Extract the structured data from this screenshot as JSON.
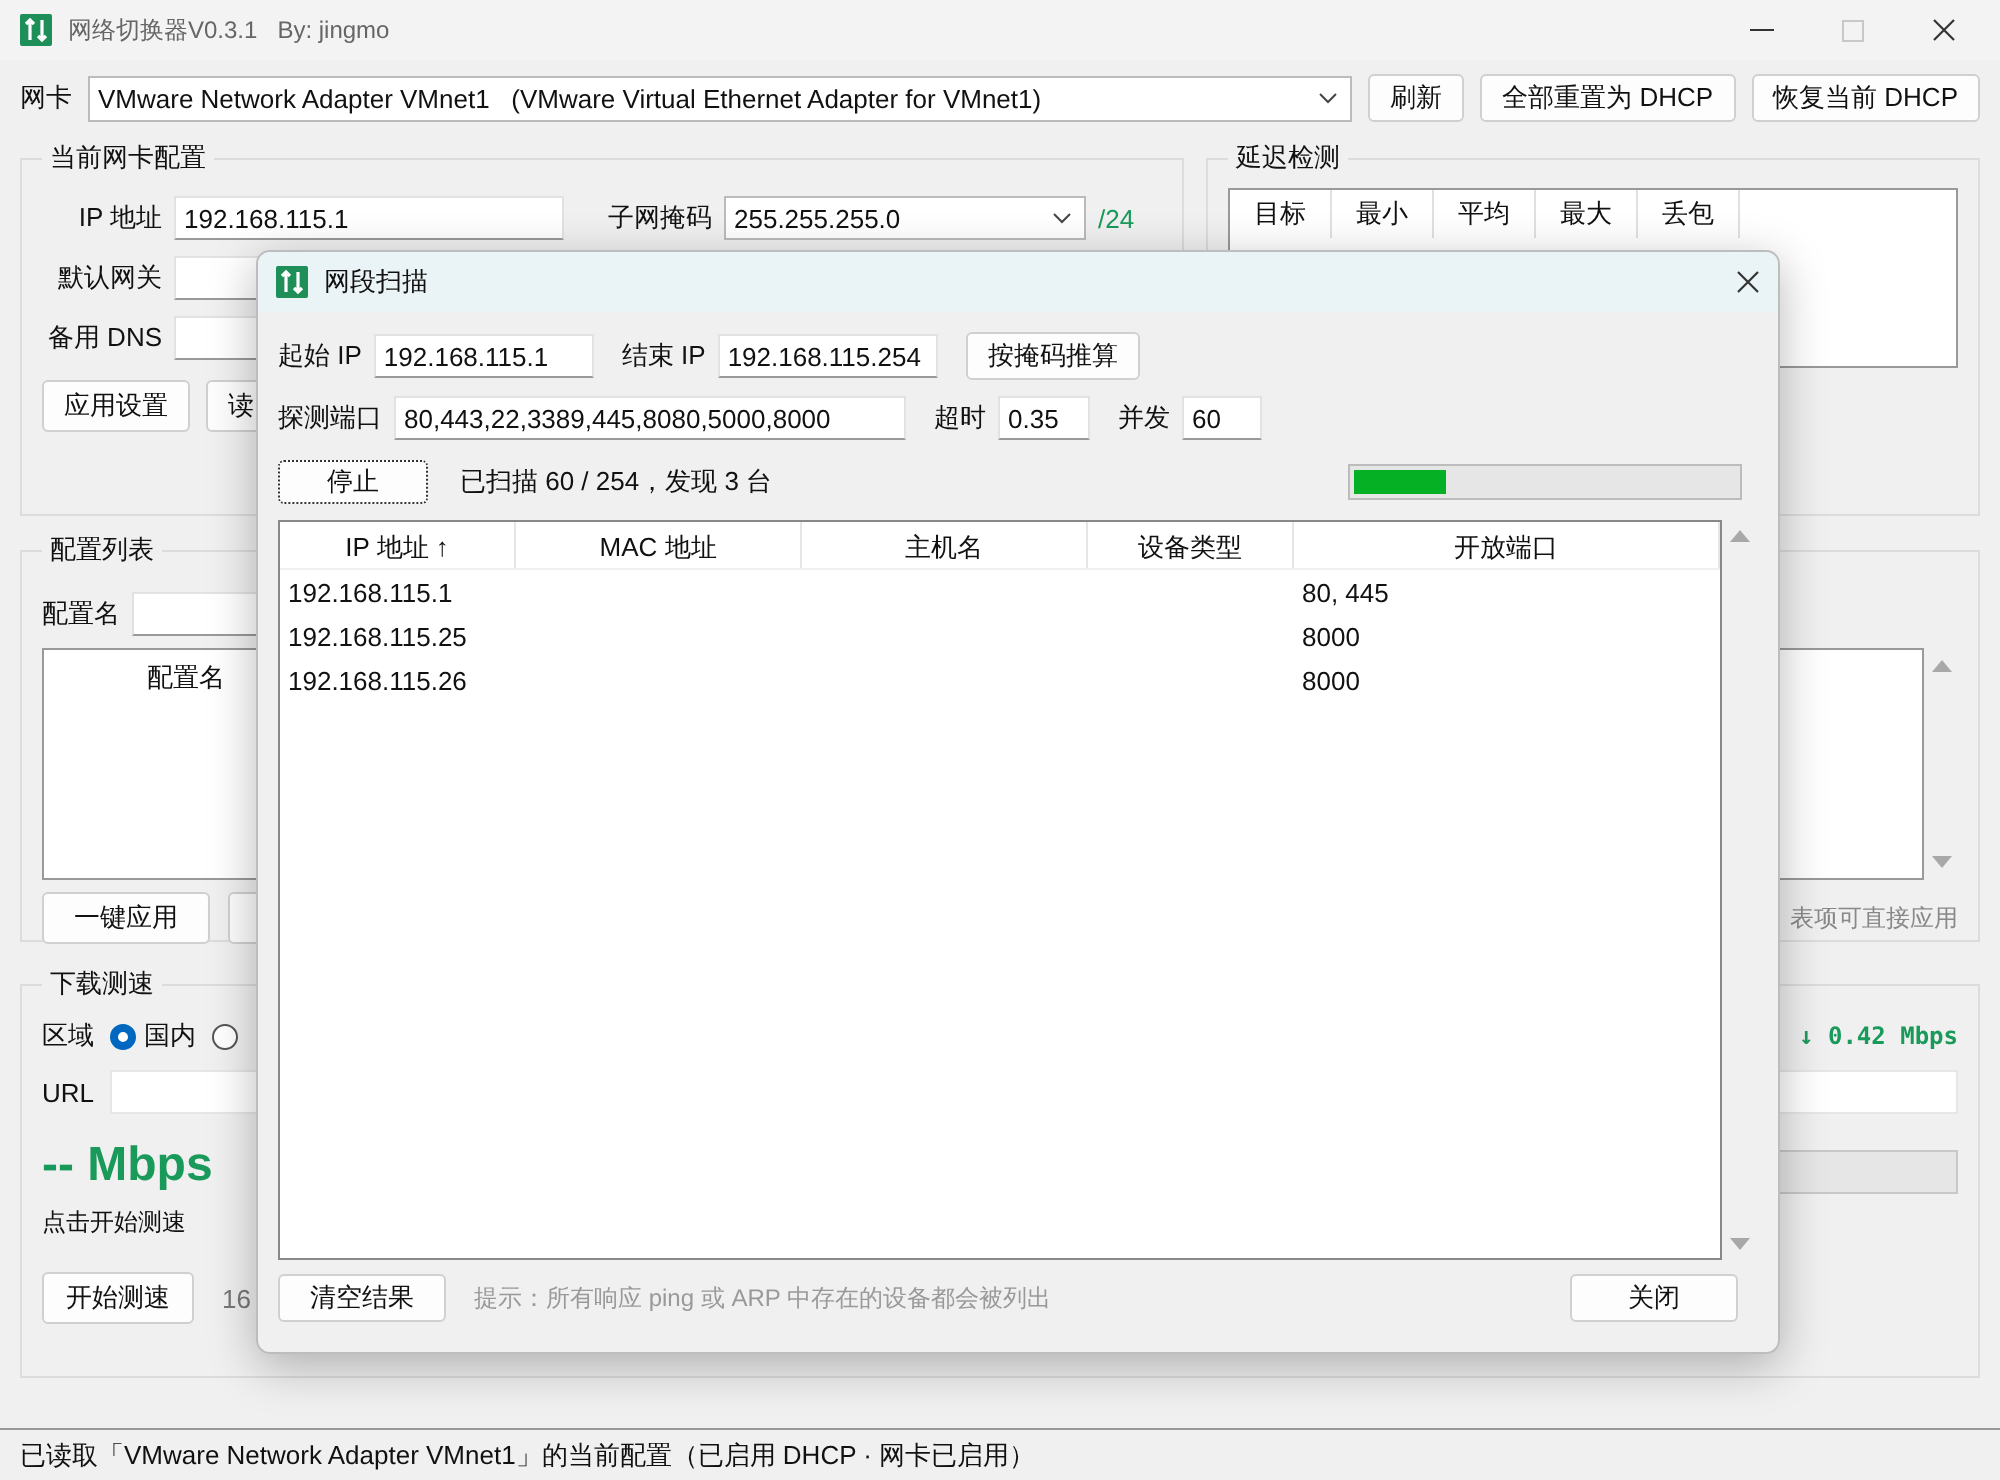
{
  "window": {
    "title": "网络切换器V0.3.1",
    "author": "By: jingmo"
  },
  "adapter": {
    "label": "网卡",
    "value": "VMware Network Adapter VMnet1   (VMware Virtual Ethernet Adapter for VMnet1)",
    "buttons": [
      "刷新",
      "全部重置为 DHCP",
      "恢复当前 DHCP"
    ]
  },
  "current_config": {
    "title": "当前网卡配置",
    "ip_label": "IP 地址",
    "ip": "192.168.115.1",
    "mask_label": "子网掩码",
    "mask": "255.255.255.0",
    "prefix": "/24",
    "gateway_label": "默认网关",
    "dns_label": "备用 DNS",
    "buttons": [
      "应用设置",
      "读"
    ]
  },
  "latency": {
    "title": "延迟检测",
    "columns": [
      "目标",
      "最小",
      "平均",
      "最大",
      "丢包"
    ]
  },
  "config_list": {
    "title": "配置列表",
    "name_label": "配置名",
    "column": "配置名",
    "buttons": [
      "一键应用"
    ],
    "hint": "表项可直接应用"
  },
  "speed_test": {
    "title": "下载测速",
    "region_label": "区域",
    "regions": [
      {
        "label": "国内",
        "selected": true
      },
      {
        "selected": false
      }
    ],
    "url_label": "URL",
    "speed": "-- Mbps",
    "hint": "点击开始测速",
    "start_button": "开始测速",
    "size": "16",
    "rate": "↓ 0.42 Mbps",
    "level": 0
  },
  "status_bar": "已读取「VMware Network Adapter VMnet1」的当前配置（已启用 DHCP · 网卡已启用）",
  "dialog": {
    "title": "网段扫描",
    "start_ip_label": "起始 IP",
    "start_ip": "192.168.115.1",
    "end_ip_label": "结束 IP",
    "end_ip": "192.168.115.254",
    "infer_button": "按掩码推算",
    "ports_label": "探测端口",
    "ports": "80,443,22,3389,445,8080,5000,8000",
    "timeout_label": "超时",
    "timeout": "0.35",
    "concurrency_label": "并发",
    "concurrency": "60",
    "stop_button": "停止",
    "progress_text": "已扫描 60 / 254，发现 3 台",
    "level": 0.24,
    "columns": [
      "IP 地址 ↑",
      "MAC 地址",
      "主机名",
      "设备类型",
      "开放端口"
    ],
    "rows": [
      {
        "ip": "192.168.115.1",
        "ports": "80, 445"
      },
      {
        "ip": "192.168.115.25",
        "ports": "8000"
      },
      {
        "ip": "192.168.115.26",
        "ports": "8000"
      }
    ],
    "clear_button": "清空结果",
    "hint": "提示：所有响应 ping 或 ARP 中存在的设备都会被列出",
    "close_button": "关闭"
  }
}
